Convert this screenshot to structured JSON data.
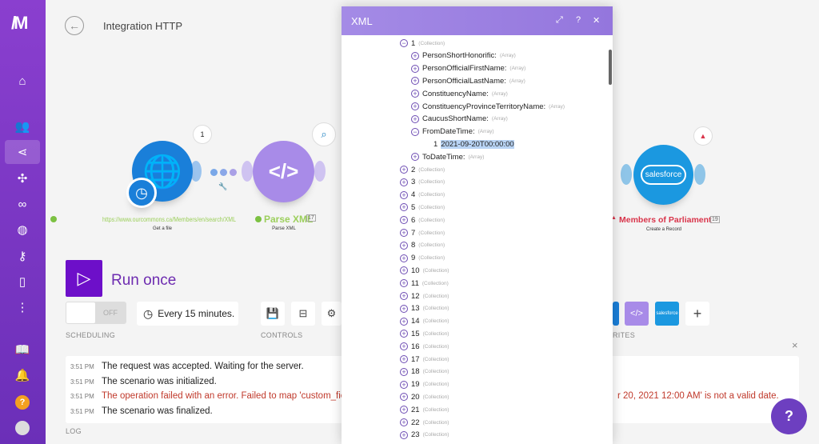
{
  "header": {
    "title": "Integration HTTP"
  },
  "modules": [
    {
      "name": "https://www.ourcommons.ca/Members/en/search/XML",
      "sub": "Get a file",
      "bubble": "1",
      "color": "#1a7fd9"
    },
    {
      "name": "Parse XML",
      "sub": "Parse XML",
      "badge": "17",
      "color": "#a88be8"
    },
    {
      "name": "Members of Parliament",
      "sub": "Create a Record",
      "badge": "19",
      "color": "#1b98e0",
      "icon_text": "salesforce"
    }
  ],
  "controls": {
    "run_label": "Run once",
    "toggle": "OFF",
    "schedule": "Every 15 minutes.",
    "scheduling_label": "SCHEDULING",
    "controls_label": "CONTROLS",
    "favorites_label": "RITES"
  },
  "log": {
    "label": "LOG",
    "rows": [
      {
        "time": "3:51 PM",
        "text": "The request was accepted. Waiting for the server.",
        "error": false
      },
      {
        "time": "3:51 PM",
        "text": "The scenario was initialized.",
        "error": false
      },
      {
        "time": "3:51 PM",
        "text": "The operation failed with an error. Failed to map 'custom_fiel",
        "text_end": "r 20, 2021 12:00 AM' is not a valid date.",
        "error": true
      },
      {
        "time": "3:51 PM",
        "text": "The scenario was finalized.",
        "error": false
      }
    ]
  },
  "modal": {
    "title": "XML",
    "tree": {
      "root": {
        "key": "1",
        "type": "(Collection)"
      },
      "children": [
        {
          "key": "PersonShortHonorific:",
          "type": "(Array)"
        },
        {
          "key": "PersonOfficialFirstName:",
          "type": "(Array)"
        },
        {
          "key": "PersonOfficialLastName:",
          "type": "(Array)"
        },
        {
          "key": "ConstituencyName:",
          "type": "(Array)"
        },
        {
          "key": "ConstituencyProvinceTerritoryName:",
          "type": "(Array)"
        },
        {
          "key": "CaucusShortName:",
          "type": "(Array)"
        },
        {
          "key": "FromDateTime:",
          "type": "(Array)",
          "expanded": true
        },
        {
          "key": "ToDateTime:",
          "type": "(Array)"
        }
      ],
      "leaf": {
        "index": "1",
        "value": "2021-09-20T00:00:00"
      },
      "collections": [
        "2",
        "3",
        "4",
        "5",
        "6",
        "7",
        "8",
        "9",
        "10",
        "11",
        "12",
        "13",
        "14",
        "15",
        "16",
        "17",
        "18",
        "19",
        "20",
        "21",
        "22",
        "23"
      ],
      "collection_type": "(Collection)"
    }
  }
}
